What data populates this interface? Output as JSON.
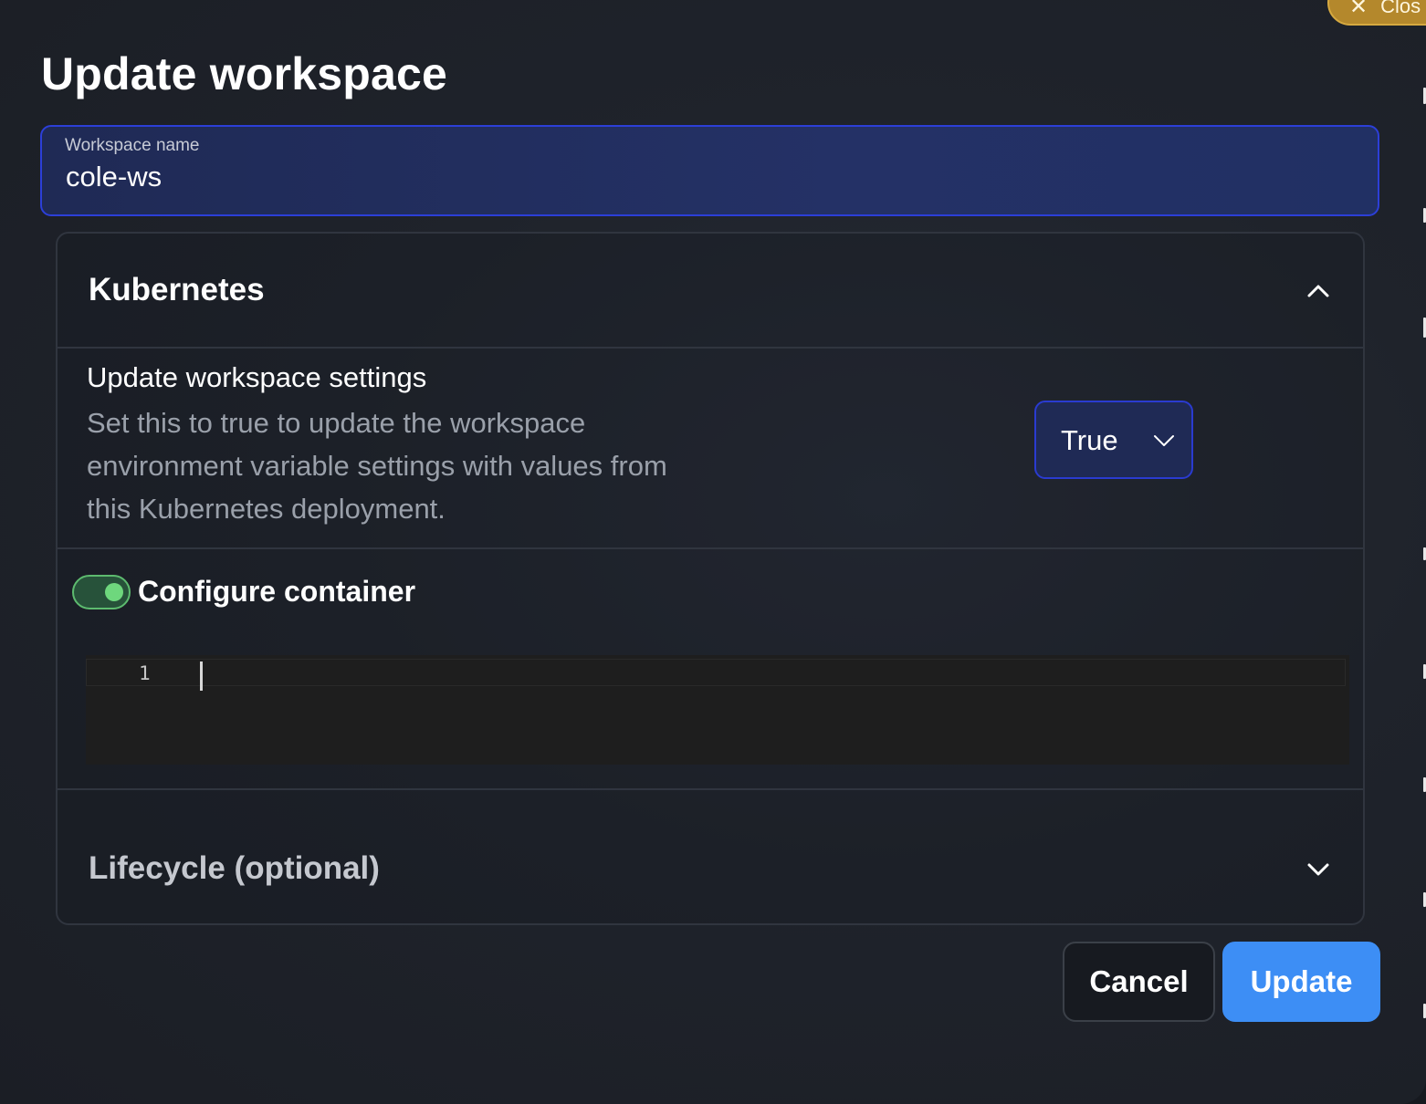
{
  "dialog": {
    "title": "Update workspace",
    "close_label": "Clos"
  },
  "workspace_name": {
    "label": "Workspace name",
    "value": "cole-ws"
  },
  "kubernetes": {
    "title": "Kubernetes",
    "expanded": true,
    "update_settings": {
      "title": "Update workspace settings",
      "description": "Set this to true to update the workspace environment variable settings with values from this Kubernetes deployment.",
      "selected": "True"
    },
    "configure_container": {
      "label": "Configure container",
      "enabled": true,
      "editor_line": "1"
    }
  },
  "lifecycle": {
    "title": "Lifecycle (optional)",
    "expanded": false
  },
  "footer": {
    "cancel_label": "Cancel",
    "update_label": "Update"
  },
  "colors": {
    "primary": "#3d8ef5",
    "field_border": "#2c3fd8",
    "toggle_on": "#6ed77d",
    "close_pill": "#b4882c"
  }
}
